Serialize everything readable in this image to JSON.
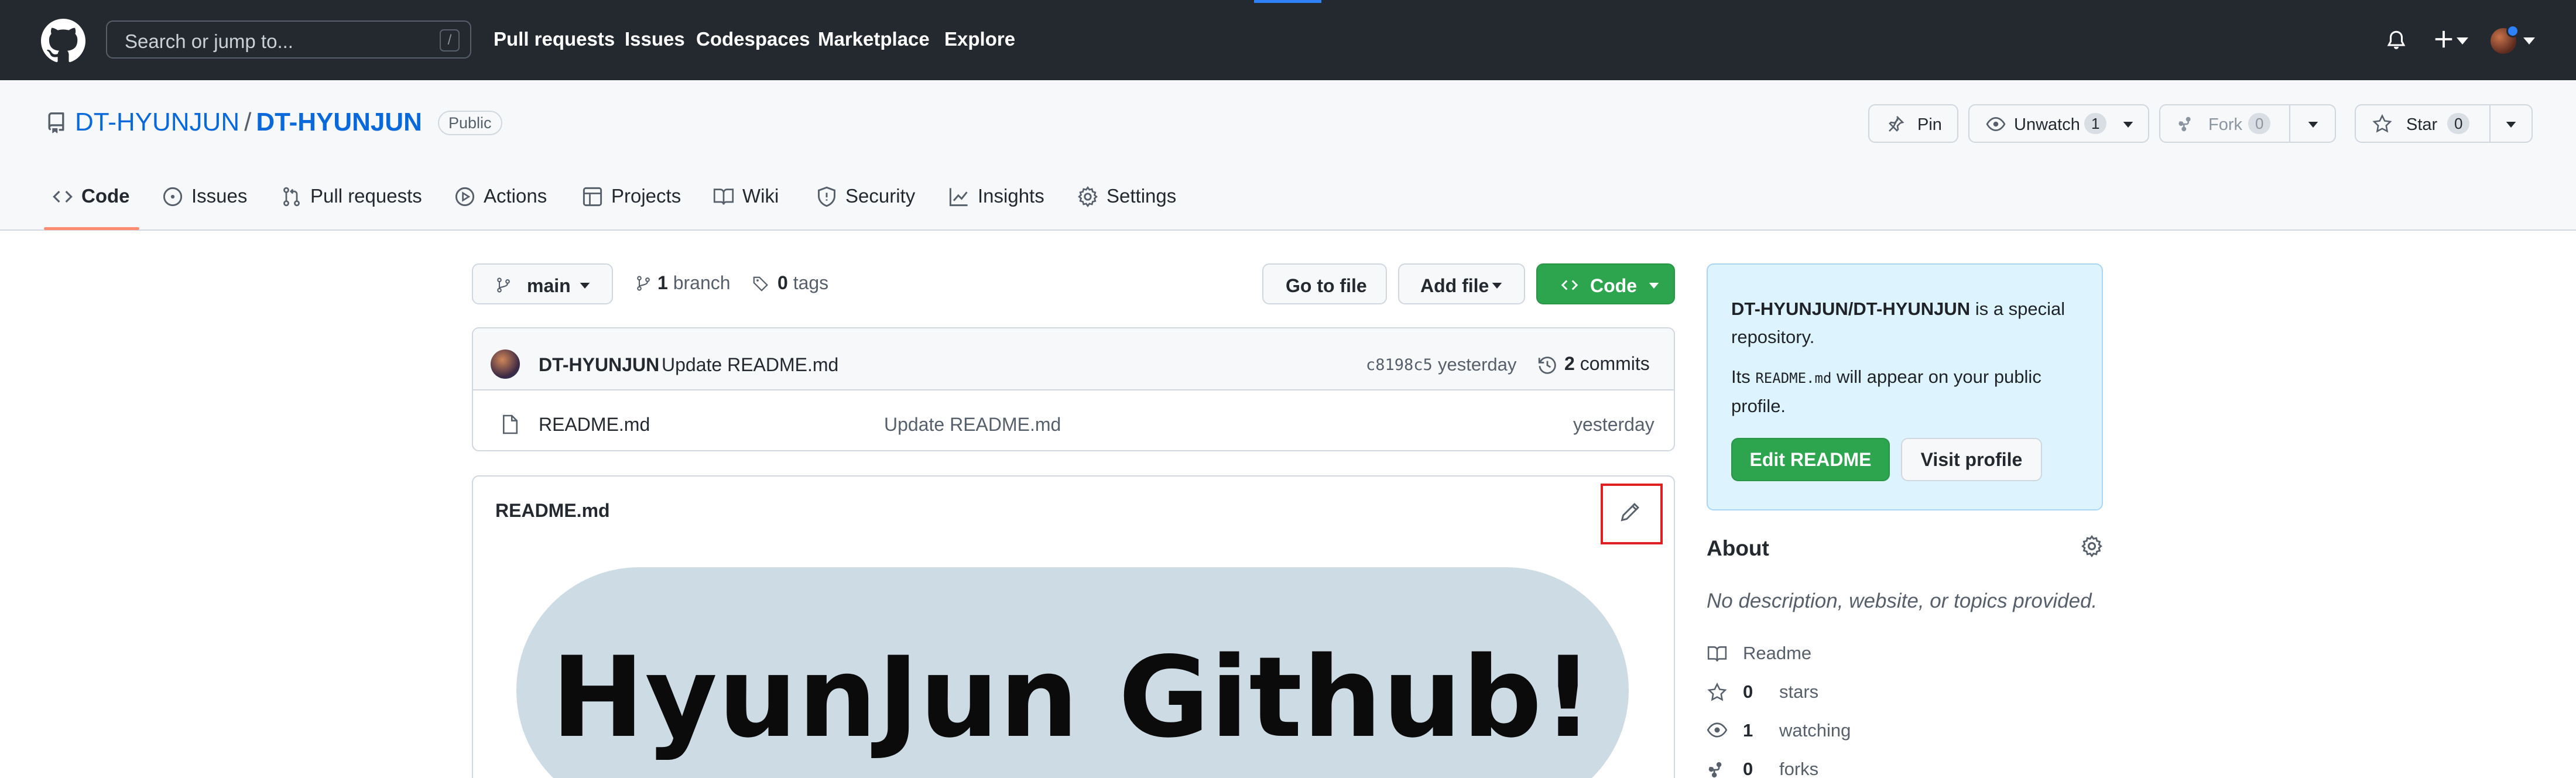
{
  "header": {
    "search_placeholder": "Search or jump to...",
    "search_shortcut": "/",
    "nav": [
      "Pull requests",
      "Issues",
      "Codespaces",
      "Marketplace",
      "Explore"
    ]
  },
  "repo": {
    "owner": "DT-HYUNJUN",
    "separator": "/",
    "name": "DT-HYUNJUN",
    "visibility": "Public",
    "pin_label": "Pin",
    "unwatch_label": "Unwatch",
    "watch_count": "1",
    "fork_label": "Fork",
    "fork_count": "0",
    "star_label": "Star",
    "star_count": "0"
  },
  "tabs": [
    {
      "label": "Code",
      "icon": "code-icon"
    },
    {
      "label": "Issues",
      "icon": "issue-opened-icon"
    },
    {
      "label": "Pull requests",
      "icon": "git-pull-request-icon"
    },
    {
      "label": "Actions",
      "icon": "play-icon"
    },
    {
      "label": "Projects",
      "icon": "table-icon"
    },
    {
      "label": "Wiki",
      "icon": "book-icon"
    },
    {
      "label": "Security",
      "icon": "shield-icon"
    },
    {
      "label": "Insights",
      "icon": "graph-icon"
    },
    {
      "label": "Settings",
      "icon": "gear-icon"
    }
  ],
  "toolbar": {
    "branch": "main",
    "branch_count": "1",
    "branch_word": "branch",
    "tag_count": "0",
    "tag_word": "tags",
    "go_to_file": "Go to file",
    "add_file": "Add file",
    "code": "Code"
  },
  "commit": {
    "author": "DT-HYUNJUN",
    "message": "Update README.md",
    "sha": "c8198c5",
    "time": "yesterday",
    "count": "2",
    "count_word": "commits"
  },
  "files": [
    {
      "name": "README.md",
      "message": "Update README.md",
      "time": "yesterday"
    }
  ],
  "readme": {
    "title": "README.md",
    "banner_text": "HyunJun Github!"
  },
  "special": {
    "repo_path": "DT-HYUNJUN/DT-HYUNJUN",
    "line1_rest": " is a special repository.",
    "its": "Its ",
    "file_code": "README.md",
    "line2_rest": " will appear on your public profile.",
    "edit_readme": "Edit README",
    "visit_profile": "Visit profile"
  },
  "about": {
    "title": "About",
    "description": "No description, website, or topics provided.",
    "readme": "Readme",
    "stars_count": "0",
    "stars_word": "stars",
    "watching_count": "1",
    "watching_word": "watching",
    "forks_count": "0",
    "forks_word": "forks"
  },
  "colors": {
    "header_bg": "#24292f",
    "link": "#0969da",
    "primary_button": "#2da44e",
    "selected_tab_underline": "#fd8c73",
    "highlight_box": "#e02020",
    "special_box_bg": "#ddf4ff"
  }
}
